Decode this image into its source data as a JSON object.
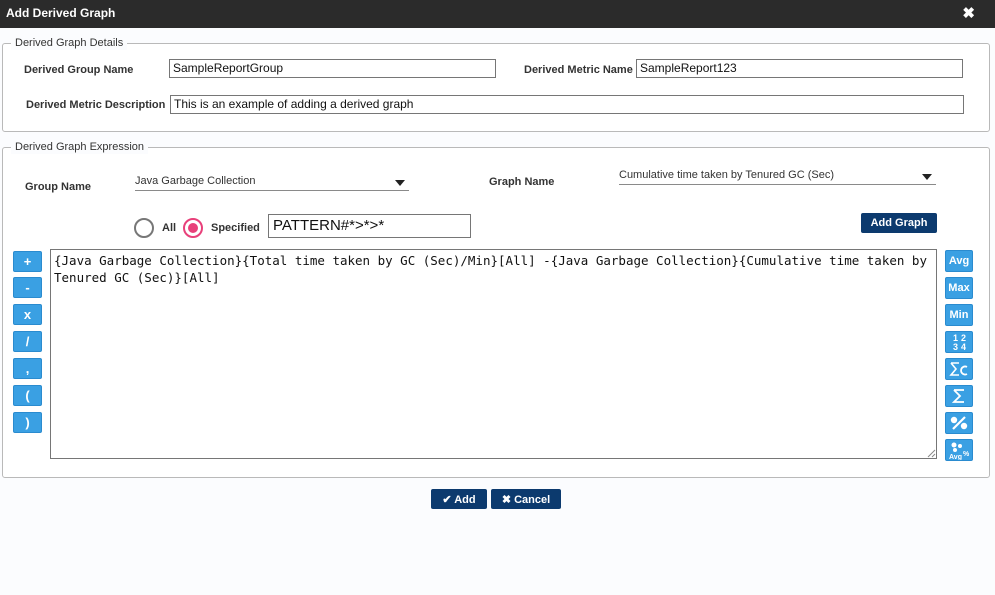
{
  "dialog": {
    "title": "Add Derived Graph"
  },
  "details": {
    "legend": "Derived Graph Details",
    "group_name_label": "Derived Group Name",
    "group_name_value": "SampleReportGroup",
    "metric_name_label": "Derived Metric Name",
    "metric_name_value": "SampleReport123",
    "description_label": "Derived Metric Description",
    "description_value": "This is an example of adding a derived graph"
  },
  "expression": {
    "legend": "Derived Graph Expression",
    "group_name_label": "Group Name",
    "group_name_selected": "Java Garbage Collection",
    "graph_name_label": "Graph Name",
    "graph_name_selected": "Cumulative time taken by Tenured GC (Sec)",
    "radio_all_label": "All",
    "radio_specified_label": "Specified",
    "selected_radio": "Specified",
    "pattern_value": "PATTERN#*>*>*",
    "add_graph_label": "Add Graph",
    "text": "{Java Garbage Collection}{Total time taken by GC (Sec)/Min}[All] -{Java Garbage Collection}{Cumulative time taken by Tenured GC (Sec)}[All]",
    "operators": [
      "+",
      "-",
      "x",
      "/",
      ",",
      "(",
      ")"
    ],
    "functions": {
      "avg": "Avg",
      "max": "Max",
      "min": "Min"
    },
    "function_icons": [
      "digits-icon",
      "sum-count-icon",
      "sigma-icon",
      "percent-icon",
      "avg-percent-icon"
    ]
  },
  "footer": {
    "add_label": "Add",
    "cancel_label": "Cancel"
  },
  "colors": {
    "titlebar": "#2b2b2b",
    "primary_button": "#0c3a6e",
    "tool_button": "#3aa0e3",
    "radio_selected": "#e8407a"
  }
}
